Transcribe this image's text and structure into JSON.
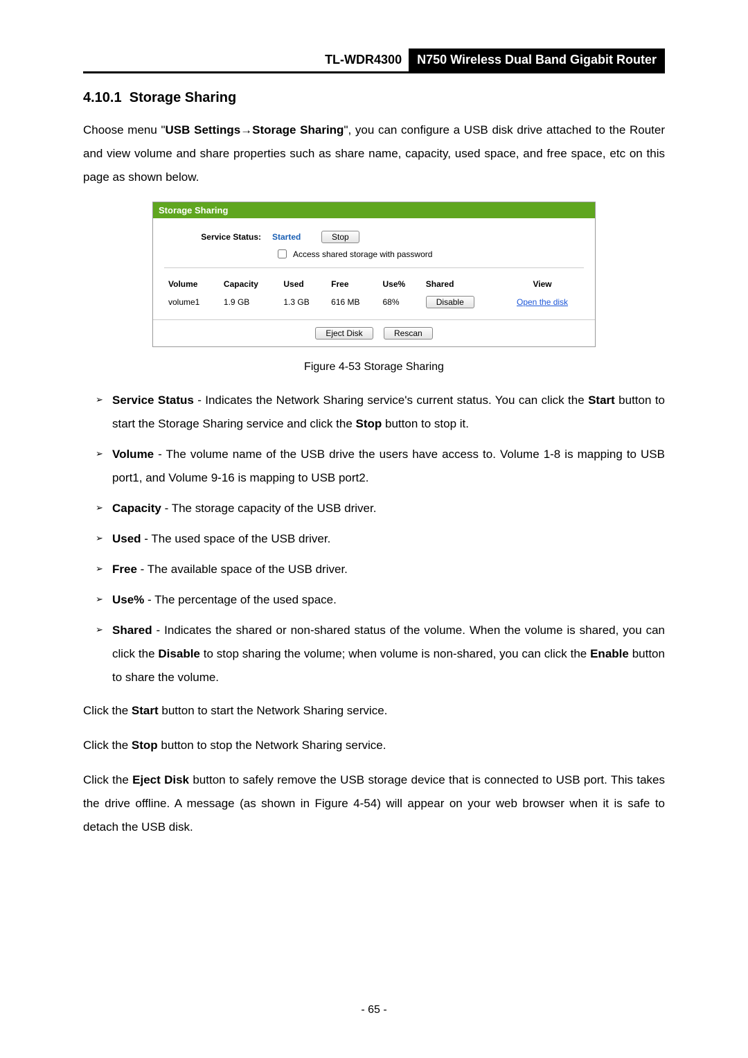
{
  "header": {
    "model": "TL-WDR4300",
    "product": "N750 Wireless Dual Band Gigabit Router"
  },
  "section": {
    "number": "4.10.1",
    "title": "Storage Sharing"
  },
  "intro": {
    "prefix": "Choose menu \"",
    "menu_path_1": "USB Settings",
    "menu_arrow": "→",
    "menu_path_2": "Storage Sharing",
    "suffix": "\", you can configure a USB disk drive attached to the Router and view volume and share properties such as share name, capacity, used space, and free space, etc on this page as shown below."
  },
  "panel": {
    "title": "Storage Sharing",
    "service_status_label": "Service Status:",
    "service_status_value": "Started",
    "stop_button": "Stop",
    "checkbox_label": "Access shared storage with password",
    "table": {
      "headers": [
        "Volume",
        "Capacity",
        "Used",
        "Free",
        "Use%",
        "Shared",
        "View"
      ],
      "row": {
        "volume": "volume1",
        "capacity": "1.9 GB",
        "used": "1.3 GB",
        "free": "616 MB",
        "use_pct": "68%",
        "shared_button": "Disable",
        "view_link": "Open the disk"
      }
    },
    "eject_button": "Eject Disk",
    "rescan_button": "Rescan"
  },
  "figure_caption": "Figure 4-53 Storage Sharing",
  "bullets": {
    "b0": {
      "term": "Service Status",
      "sep": " - ",
      "t1": "Indicates the Network Sharing service's current status. You can click the ",
      "k1": "Start",
      "t2": " button to start the Storage Sharing service and click the ",
      "k2": "Stop",
      "t3": " button to stop it."
    },
    "b1": {
      "term": "Volume",
      "sep": " - ",
      "t1": "The volume name of the USB drive the users have access to. Volume 1-8 is mapping to USB port1, and Volume 9-16 is mapping to USB port2."
    },
    "b2": {
      "term": "Capacity",
      "sep": " - ",
      "t1": "The storage capacity of the USB driver."
    },
    "b3": {
      "term": "Used",
      "sep": " - ",
      "t1": "The used space of the USB driver."
    },
    "b4": {
      "term": "Free",
      "sep": " - ",
      "t1": "The available space of the USB driver."
    },
    "b5": {
      "term": "Use%",
      "sep": " - ",
      "t1": "The percentage of the used space."
    },
    "b6": {
      "term": "Shared",
      "sep": " - ",
      "t1": "Indicates the shared or non-shared status of the volume. When the volume is shared, you can click the ",
      "k1": "Disable",
      "t2": " to stop sharing the volume; when volume is non-shared, you can click the ",
      "k2": "Enable",
      "t3": " button to share the volume."
    }
  },
  "paras": {
    "p0": {
      "t1": "Click the ",
      "k1": "Start",
      "t2": " button to start the Network Sharing service."
    },
    "p1": {
      "t1": "Click the ",
      "k1": "Stop",
      "t2": " button to stop the Network Sharing service."
    },
    "p2": {
      "t1": "Click the ",
      "k1": "Eject Disk",
      "t2": " button to safely remove the USB storage device that is connected to USB port. This takes the drive offline. A message (as shown in Figure 4-54) will appear on your web browser when it is safe to detach the USB disk."
    }
  },
  "page_number": "- 65 -"
}
